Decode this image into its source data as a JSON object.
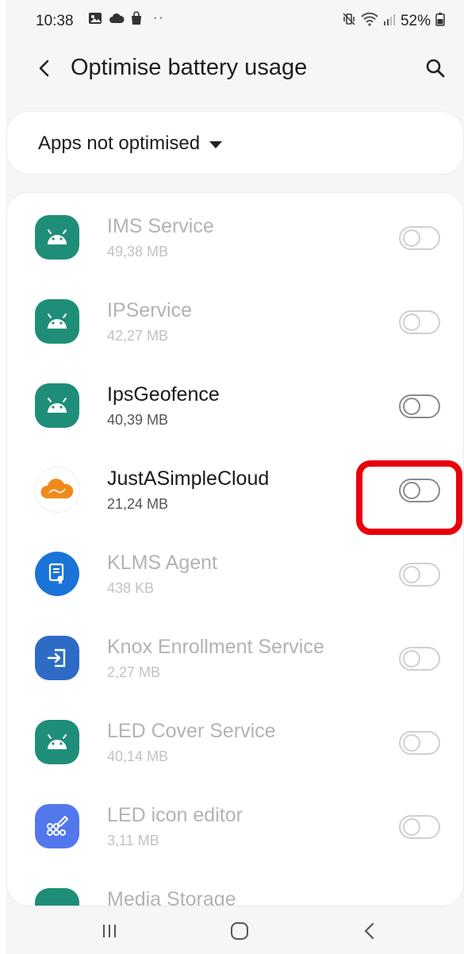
{
  "status_bar": {
    "time": "10:38",
    "battery": "52%",
    "icons_left": [
      "gallery-icon",
      "cloud-icon",
      "bag-icon",
      "more-dots-icon"
    ],
    "icons_right": [
      "mute-vibrate-icon",
      "wifi-icon",
      "signal-icon",
      "battery-icon"
    ]
  },
  "app_bar": {
    "title": "Optimise battery usage",
    "back_icon": "chevron-left-icon",
    "search_icon": "search-icon"
  },
  "filter": {
    "label": "Apps not optimised",
    "icon": "dropdown-caret-icon"
  },
  "apps": [
    {
      "name": "IMS Service",
      "size": "49,38 MB",
      "icon": "android-icon",
      "enabled": false,
      "toggle_on": false
    },
    {
      "name": "IPService",
      "size": "42,27 MB",
      "icon": "android-icon",
      "enabled": false,
      "toggle_on": false
    },
    {
      "name": "IpsGeofence",
      "size": "40,39 MB",
      "icon": "android-icon",
      "enabled": true,
      "toggle_on": false
    },
    {
      "name": "JustASimpleCloud",
      "size": "21,24 MB",
      "icon": "cloud-app-icon",
      "enabled": true,
      "toggle_on": false,
      "highlighted": true
    },
    {
      "name": "KLMS Agent",
      "size": "438 KB",
      "icon": "klms-agent-icon",
      "enabled": false,
      "toggle_on": false
    },
    {
      "name": "Knox Enrollment Service",
      "size": "2,27 MB",
      "icon": "knox-enroll-icon",
      "enabled": false,
      "toggle_on": false
    },
    {
      "name": "LED Cover Service",
      "size": "40,14 MB",
      "icon": "android-icon",
      "enabled": false,
      "toggle_on": false
    },
    {
      "name": "LED icon editor",
      "size": "3,11 MB",
      "icon": "led-editor-icon",
      "enabled": false,
      "toggle_on": false
    }
  ],
  "partial_app": {
    "name": "Media Storage",
    "icon": "android-icon"
  },
  "colors": {
    "android_icon": "#1f8e79",
    "highlight": "#e8000b",
    "klms_icon": "#1b73d8",
    "knox_icon": "#2d6bc7",
    "led_icon": "#5378ee",
    "cloud_icon": "#f08a1c"
  },
  "nav_bar": {
    "recents_icon": "recents-icon",
    "home_icon": "home-icon",
    "back_icon": "back-icon"
  }
}
